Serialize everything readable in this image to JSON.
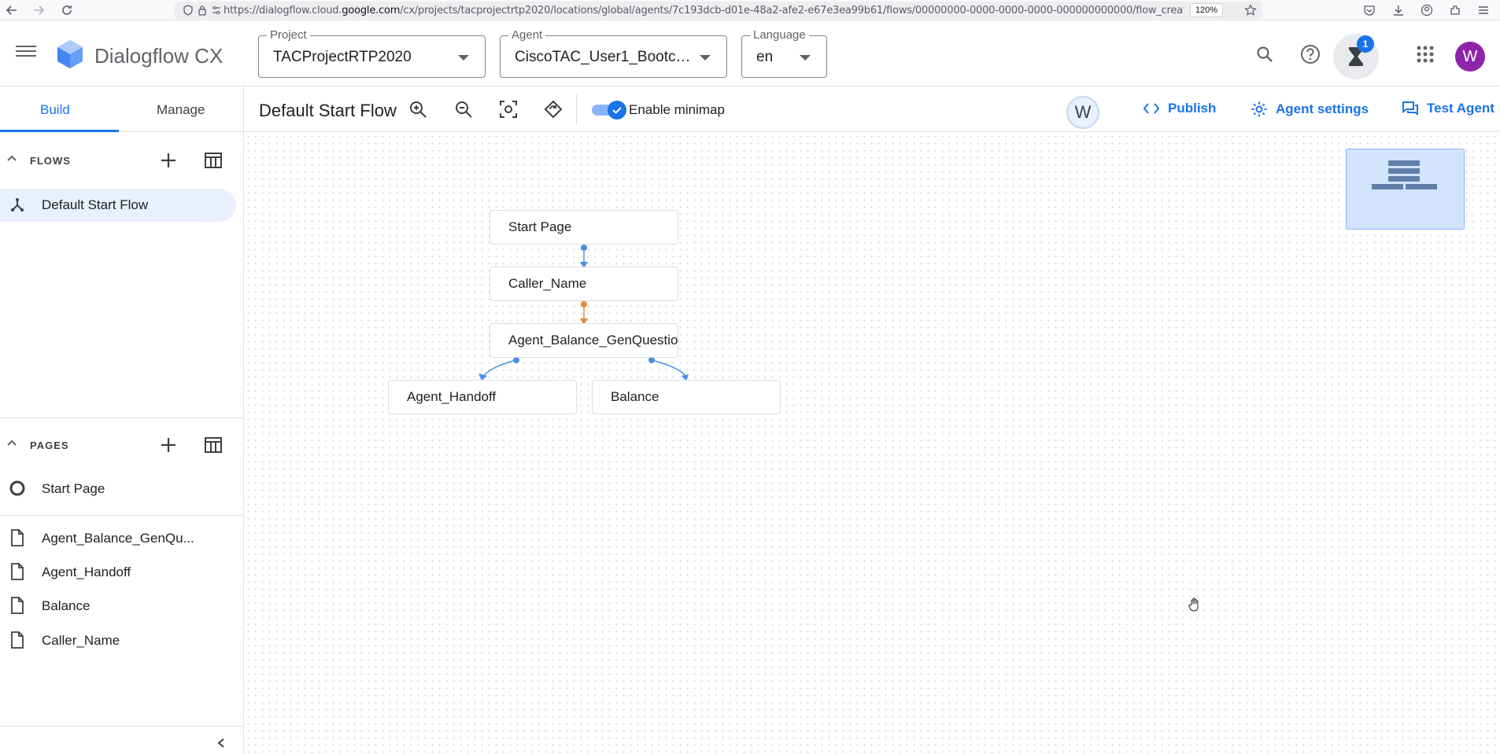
{
  "browser": {
    "url_prefix": "https://dialogflow.cloud.",
    "url_host": "google.com",
    "url_rest": "/cx/projects/tacprojectrtp2020/locations/global/agents/7c193dcb-d01e-48a2-afe2-e67e3ea99b61/flows/00000000-0000-0000-0000-000000000000/flow_creati",
    "zoom": "120%"
  },
  "header": {
    "app_name": "Dialogflow CX",
    "project_label": "Project",
    "project_value": "TACProjectRTP2020",
    "agent_label": "Agent",
    "agent_value": "CiscoTAC_User1_Bootca...",
    "language_label": "Language",
    "language_value": "en",
    "notification_count": "1",
    "avatar_letter": "W"
  },
  "sidebar": {
    "tabs": [
      {
        "label": "Build"
      },
      {
        "label": "Manage"
      }
    ],
    "flows_title": "FLOWS",
    "flows": [
      {
        "label": "Default Start Flow"
      }
    ],
    "pages_title": "PAGES",
    "pages": [
      {
        "label": "Start Page",
        "icon": "start-page-icon"
      },
      {
        "label": "Agent_Balance_GenQu...",
        "icon": "page-icon"
      },
      {
        "label": "Agent_Handoff",
        "icon": "page-icon"
      },
      {
        "label": "Balance",
        "icon": "page-icon"
      },
      {
        "label": "Caller_Name",
        "icon": "page-icon"
      }
    ]
  },
  "toolbar": {
    "flow_title": "Default Start Flow",
    "minimap_label": "Enable minimap",
    "minimap_enabled": true,
    "user_initial": "W",
    "publish": "Publish",
    "agent_settings": "Agent settings",
    "test_agent": "Test Agent"
  },
  "graph": {
    "nodes": [
      {
        "id": "start",
        "label": "Start Page"
      },
      {
        "id": "caller",
        "label": "Caller_Name"
      },
      {
        "id": "genq",
        "label": "Agent_Balance_GenQuestion"
      },
      {
        "id": "handoff",
        "label": "Agent_Handoff"
      },
      {
        "id": "balance",
        "label": "Balance"
      }
    ],
    "edges": [
      {
        "from": "start",
        "to": "caller",
        "color": "#4a90e2"
      },
      {
        "from": "caller",
        "to": "genq",
        "color": "#e6893c"
      },
      {
        "from": "genq",
        "to": "handoff",
        "color": "#4a90e2"
      },
      {
        "from": "genq",
        "to": "balance",
        "color": "#4a90e2"
      }
    ]
  },
  "colors": {
    "accent": "#1a73e8",
    "active_bg": "#e8f0fe",
    "avatar": "#8e24aa"
  }
}
